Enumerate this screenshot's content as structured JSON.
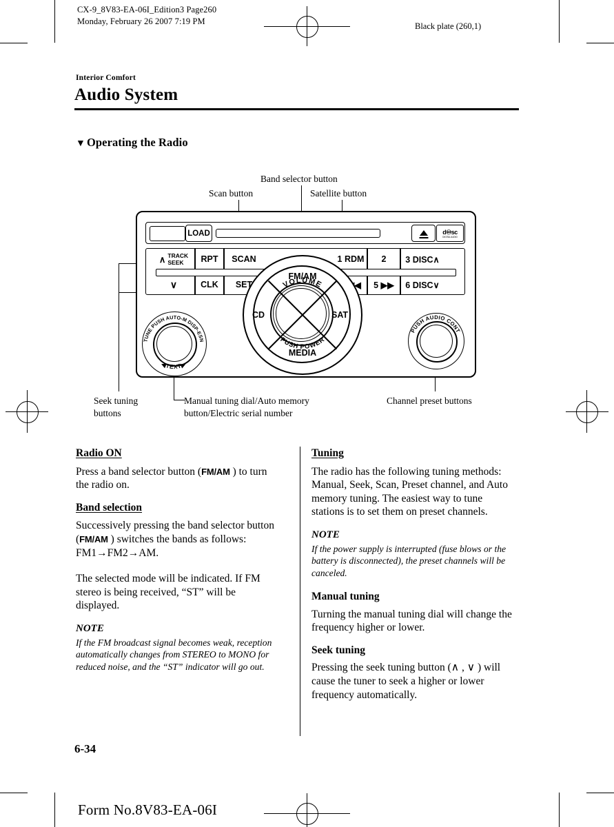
{
  "header": {
    "left_line1": "CX-9_8V83-EA-06I_Edition3 Page260",
    "left_line2": "Monday, February 26 2007 7:19 PM",
    "right": "Black plate (260,1)"
  },
  "section": {
    "kicker": "Interior Comfort",
    "title": "Audio System",
    "subhead_marker": "▼",
    "subhead": "Operating the Radio"
  },
  "figure": {
    "callouts": {
      "band_selector": "Band selector button",
      "scan": "Scan button",
      "satellite": "Satellite button",
      "seek_tuning": "Seek tuning\nbuttons",
      "seek_tuning_l1": "Seek tuning",
      "seek_tuning_l2": "buttons",
      "manual_tuning_l1": "Manual tuning dial/Auto memory",
      "manual_tuning_l2": "button/Electric serial number",
      "channel_preset": "Channel preset buttons"
    },
    "radio": {
      "load_label": "LOAD",
      "eject_icon": "eject-icon",
      "cd_logo_line1": "disc",
      "cd_logo_line2": "DIGITAL AUDIO",
      "buttons_top": [
        {
          "id": "track-seek",
          "glyph": "∧",
          "line1": "TRACK",
          "line2": "SEEK"
        },
        {
          "id": "rpt",
          "label": "RPT"
        },
        {
          "id": "scan",
          "label": "SCAN"
        }
      ],
      "buttons_bottom": [
        {
          "id": "seek-down",
          "label": "∨"
        },
        {
          "id": "clk",
          "label": "CLK"
        },
        {
          "id": "set",
          "label": "SET"
        }
      ],
      "presets_top": [
        {
          "id": "preset-1",
          "label": "1 RDM"
        },
        {
          "id": "preset-2",
          "label": "2"
        },
        {
          "id": "preset-3",
          "label": "3 DISC∧"
        }
      ],
      "presets_bottom": [
        {
          "id": "preset-4",
          "label": "4 ◀◀"
        },
        {
          "id": "preset-5",
          "label": "5 ▶▶"
        },
        {
          "id": "preset-6",
          "label": "6 DISC∨"
        }
      ],
      "dial": {
        "top": "FM/AM",
        "left": "CD",
        "right": "SAT",
        "bottom": "MEDIA",
        "inner_top": "VOLUME",
        "inner_bottom": "PUSH POWER"
      },
      "left_knob": {
        "arc_top": "TUNE PUSH AUTO-M DISP-ESN",
        "arc_bottom": "TEXT",
        "arrow_left": "◀",
        "arrow_right": "▶"
      },
      "right_knob": {
        "arc_top": "PUSH AUDIO CONT"
      }
    }
  },
  "left_column": {
    "radio_on_heading": "Radio ON",
    "radio_on_p1_a": "Press a band selector button (",
    "radio_on_p1_kbd": "FM/AM",
    "radio_on_p1_b": " ) to turn the radio on.",
    "band_selection_heading": "Band selection",
    "band_p1_a": "Successively pressing the band selector button (",
    "band_p1_kbd": "FM/AM",
    "band_p1_b": " ) switches the bands as follows: FM1→FM2→AM.",
    "band_p2": "The selected mode will be indicated. If FM stereo is being received, “ST” will be displayed.",
    "note_heading": "NOTE",
    "note_body": "If the FM broadcast signal becomes weak, reception automatically changes from STEREO to MONO for reduced noise, and the “ST” indicator will go out."
  },
  "right_column": {
    "tuning_heading": "Tuning",
    "tuning_p1": "The radio has the following tuning methods: Manual, Seek, Scan, Preset channel, and Auto memory tuning. The easiest way to tune stations is to set them on preset channels.",
    "note_heading": "NOTE",
    "note_body": "If the power supply is interrupted (fuse blows or the battery is disconnected), the preset channels will be canceled.",
    "manual_heading": "Manual tuning",
    "manual_p1": "Turning the manual tuning dial will change the frequency higher or lower.",
    "seek_heading": "Seek tuning",
    "seek_p1": "Pressing the seek tuning button (∧ , ∨ ) will cause the tuner to seek a higher or lower frequency automatically."
  },
  "footer": {
    "page_number": "6-34",
    "form_number": "Form No.8V83-EA-06I"
  }
}
